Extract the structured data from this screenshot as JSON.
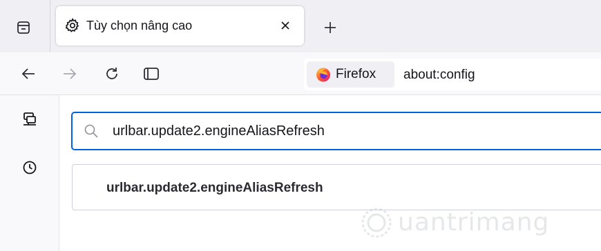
{
  "tab": {
    "title": "Tùy chọn nâng cao",
    "icon": "gear-icon"
  },
  "urlbar": {
    "identity_label": "Firefox",
    "url": "about:config"
  },
  "search": {
    "value": "urlbar.update2.engineAliasRefresh"
  },
  "results": [
    {
      "name": "urlbar.update2.engineAliasRefresh"
    }
  ],
  "watermark": {
    "text": "uantrimang"
  },
  "colors": {
    "accent": "#0061e0",
    "tabstrip": "#f0f0f4",
    "toolbar": "#f9f9fb"
  }
}
